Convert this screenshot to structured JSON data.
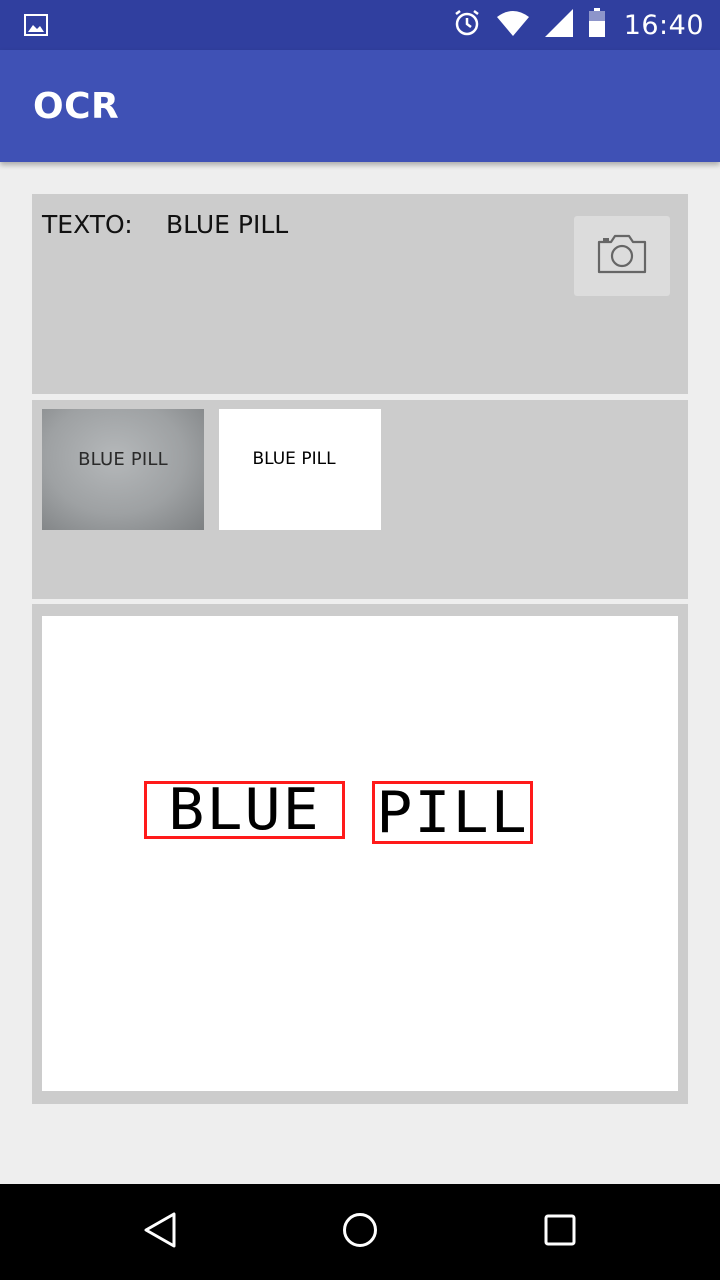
{
  "status_bar": {
    "time": "16:40",
    "icons": [
      "gallery-icon",
      "alarm-icon",
      "wifi-icon",
      "signal-icon",
      "battery-icon"
    ]
  },
  "app_bar": {
    "title": "OCR",
    "color": "#3f51b5"
  },
  "result": {
    "label": "TEXTO:",
    "value": "BLUE PILL",
    "camera_icon": "camera-icon"
  },
  "thumbnails": {
    "original_text": "BLUE PILL",
    "binarized_text": "BLUE PILL"
  },
  "detection": {
    "words": [
      "BLUE",
      "PILL"
    ],
    "box_color": "#ff1a1a"
  },
  "nav_bar": {
    "icons": [
      "back-icon",
      "home-icon",
      "recents-icon"
    ]
  }
}
